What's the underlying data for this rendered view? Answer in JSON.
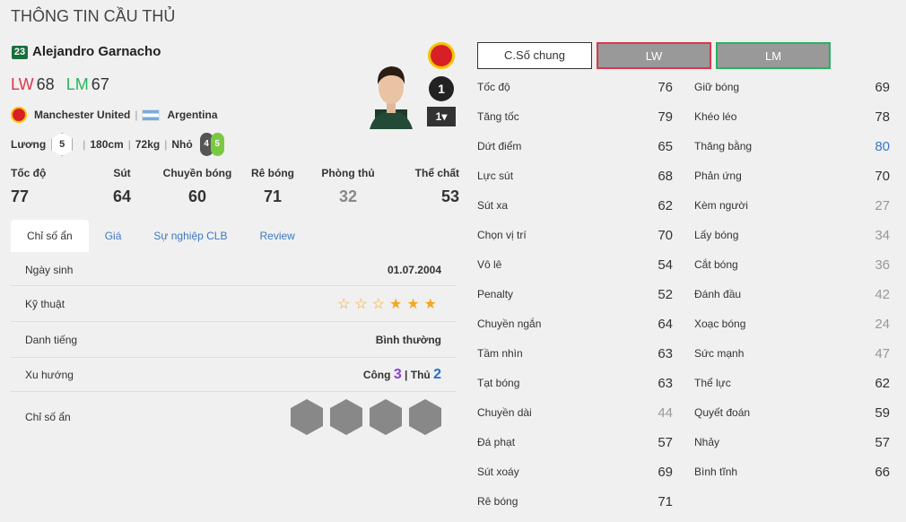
{
  "header": {
    "title": "THÔNG TIN CẦU THỦ"
  },
  "player": {
    "number": "23",
    "name": "Alejandro Garnacho",
    "positions": [
      {
        "pos": "LW",
        "ovr": "68"
      },
      {
        "pos": "LM",
        "ovr": "67"
      }
    ],
    "club": "Manchester United",
    "nation": "Argentina",
    "salary_label": "Lương",
    "salary": "5",
    "height": "180cm",
    "weight": "72kg",
    "body": "Nhỏ",
    "foot_left": "4",
    "foot_right": "5",
    "level": "1",
    "upgrade": "1▾"
  },
  "main_stats": [
    {
      "label": "Tốc độ",
      "value": "77"
    },
    {
      "label": "Sút",
      "value": "64"
    },
    {
      "label": "Chuyền bóng",
      "value": "60"
    },
    {
      "label": "Rê bóng",
      "value": "71"
    },
    {
      "label": "Phòng thủ",
      "value": "32"
    },
    {
      "label": "Thể chất",
      "value": "53"
    }
  ],
  "tabs": [
    "Chỉ số ẩn",
    "Giá",
    "Sự nghiệp CLB",
    "Review"
  ],
  "panel": {
    "birth_label": "Ngày sinh",
    "birth": "01.07.2004",
    "skill_label": "Kỹ thuật",
    "skill_stars": 3,
    "rep_label": "Danh tiếng",
    "rep": "Bình thường",
    "trend_label": "Xu hướng",
    "attack_label": "Công",
    "attack": "3",
    "defense_label": "Thủ",
    "defense": "2",
    "hidden_label": "Chỉ số ẩn"
  },
  "buttons": {
    "general": "C.Số chung",
    "lw": "LW",
    "lm": "LM"
  },
  "colors": {
    "lw": "#e0344b",
    "lm": "#26b35e",
    "link": "#3a78c3",
    "star": "#f5a623"
  },
  "attributes_left": [
    {
      "label": "Tốc độ",
      "value": "76"
    },
    {
      "label": "Tăng tốc",
      "value": "79"
    },
    {
      "label": "Dứt điểm",
      "value": "65"
    },
    {
      "label": "Lực sút",
      "value": "68"
    },
    {
      "label": "Sút xa",
      "value": "62"
    },
    {
      "label": "Chọn vị trí",
      "value": "70"
    },
    {
      "label": "Vô lê",
      "value": "54"
    },
    {
      "label": "Penalty",
      "value": "52"
    },
    {
      "label": "Chuyền ngắn",
      "value": "64"
    },
    {
      "label": "Tầm nhìn",
      "value": "63"
    },
    {
      "label": "Tạt bóng",
      "value": "63"
    },
    {
      "label": "Chuyền dài",
      "value": "44"
    },
    {
      "label": "Đá phạt",
      "value": "57"
    },
    {
      "label": "Sút xoáy",
      "value": "69"
    },
    {
      "label": "Rê bóng",
      "value": "71"
    }
  ],
  "attributes_right": [
    {
      "label": "Giữ bóng",
      "value": "69"
    },
    {
      "label": "Khéo léo",
      "value": "78"
    },
    {
      "label": "Thăng bằng",
      "value": "80"
    },
    {
      "label": "Phản ứng",
      "value": "70"
    },
    {
      "label": "Kèm người",
      "value": "27"
    },
    {
      "label": "Lấy bóng",
      "value": "34"
    },
    {
      "label": "Cắt bóng",
      "value": "36"
    },
    {
      "label": "Đánh đầu",
      "value": "42"
    },
    {
      "label": "Xoạc bóng",
      "value": "24"
    },
    {
      "label": "Sức mạnh",
      "value": "47"
    },
    {
      "label": "Thể lực",
      "value": "62"
    },
    {
      "label": "Quyết đoán",
      "value": "59"
    },
    {
      "label": "Nhảy",
      "value": "57"
    },
    {
      "label": "Bình tĩnh",
      "value": "66"
    }
  ]
}
